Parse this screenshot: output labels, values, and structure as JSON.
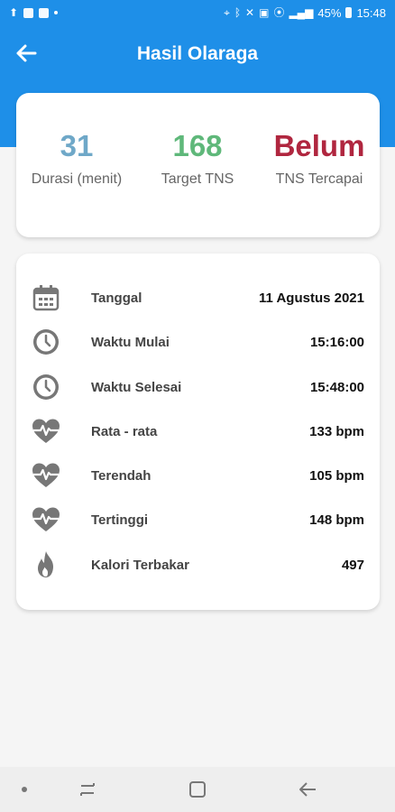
{
  "status_bar": {
    "battery": "45%",
    "time": "15:48"
  },
  "header": {
    "title": "Hasil Olaraga",
    "background": "#1e8fe8"
  },
  "summary": [
    {
      "value": "31",
      "label": "Durasi (menit)",
      "color": "#6fa8c8"
    },
    {
      "value": "168",
      "label": "Target TNS",
      "color": "#5fb87a"
    },
    {
      "value": "Belum",
      "label": "TNS Tercapai",
      "color": "#b0263f"
    }
  ],
  "details": [
    {
      "icon": "calendar-icon",
      "label": "Tanggal",
      "value": "11 Agustus 2021"
    },
    {
      "icon": "clock-icon",
      "label": "Waktu Mulai",
      "value": "15:16:00"
    },
    {
      "icon": "clock-icon",
      "label": "Waktu Selesai",
      "value": "15:48:00"
    },
    {
      "icon": "heart-rate-icon",
      "label": "Rata - rata",
      "value": "133 bpm"
    },
    {
      "icon": "heart-rate-icon",
      "label": "Terendah",
      "value": "105 bpm"
    },
    {
      "icon": "heart-rate-icon",
      "label": "Tertinggi",
      "value": "148 bpm"
    },
    {
      "icon": "fire-icon",
      "label": "Kalori Terbakar",
      "value": "497"
    }
  ]
}
